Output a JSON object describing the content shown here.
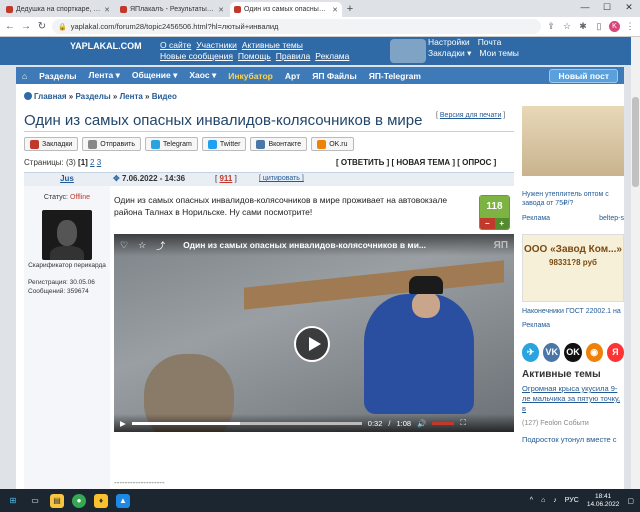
{
  "browser": {
    "tabs": [
      {
        "label": "Дедушка на спорткаре, пытаю"
      },
      {
        "label": "ЯПлакалъ - Результаты поиска"
      },
      {
        "label": "Один из самых опасных инвал"
      }
    ],
    "active_tab": 2,
    "new_tab": "+",
    "url": "yaplakal.com/forum28/topic2456506.html?hl=лютый+инвалид",
    "profile_letter": "K"
  },
  "site": {
    "logo": "YAPLAKAL.COM",
    "links_row1": [
      "О сайте",
      "Участники",
      "Активные темы"
    ],
    "links_row2": [
      "Новые сообщения",
      "Помощь",
      "Правила",
      "Реклама"
    ],
    "right_row1": [
      "Настройки",
      "Почта"
    ],
    "right_row2": [
      "Закладки ▾",
      "Мои темы"
    ]
  },
  "menu": {
    "items": [
      "Разделы",
      "Лента ▾",
      "Общение ▾",
      "Хаос ▾",
      "Инкубатор",
      "Арт",
      "ЯП Файлы",
      "ЯП-Telegram"
    ],
    "new_post": "Новый пост"
  },
  "breadcrumb": [
    "Главная",
    "Разделы",
    "Лента",
    "Видео"
  ],
  "topic": {
    "title": "Один из самых опасных инвалидов-колясочников в мире",
    "print_version": "Версия для печати"
  },
  "share": [
    "Закладки",
    "Отправить",
    "Telegram",
    "Twitter",
    "Вконтакте",
    "OK.ru"
  ],
  "pagination": {
    "label": "Страницы:",
    "count": "(3)",
    "current": "[1]",
    "others": [
      "2",
      "3"
    ]
  },
  "actions": "[ ОТВЕТИТЬ ] [ НОВАЯ ТЕМА ] [ ОПРОС ]",
  "post": {
    "author": "Jus",
    "date": "7.06.2022 - 14:36",
    "number": "911",
    "cite": "[ цитировать ]",
    "status_label": "Статус:",
    "status_value": "Offline",
    "user_title": "Скарификатор перикарда",
    "reg": "Регистрация: 30.05.06",
    "messages": "Сообщений: 359674",
    "text": "Один из самых опасных инвалидов-колясочников в мире проживает на автовокзале района Талнах в Норильске. Ну сами посмотрите!",
    "rating": "118",
    "rating_minus": "−",
    "rating_plus": "+",
    "separator": "-------------------"
  },
  "video": {
    "title": "Один из самых опасных инвалидов-колясочников в ми...",
    "watermark": "ЯП",
    "time_current": "0:32",
    "time_sep": "/",
    "time_total": "1:08",
    "progress": 0.47
  },
  "sidebar": {
    "ad1_text": "Нужен утеплитель оптом с завода от 75₽/?",
    "ad1_src": [
      "Реклама",
      "belteр-s"
    ],
    "ad2_title": "ООО «Завод Ком...»",
    "ad2_num": "98331?8 руб",
    "ad2_text": "Наконечники ГОСТ 22002.1 на",
    "ad2_src": "Реклама",
    "socials": [
      "✈",
      "VK",
      "OK",
      "◉",
      "Я"
    ],
    "active_title": "Активные темы",
    "active_link": "Огромная крыса укусила 9-ле мальчика за пятую точку, в",
    "active_meta": "(127)  Feolon  Событи",
    "active_link2": "Подросток утонул вместе с"
  },
  "taskbar": {
    "lang": "РУС",
    "time": "18:41",
    "date": "14.06.2022"
  },
  "colors": {
    "header": "#2f6aa6",
    "menu": "#3e7ab8",
    "accent": "#c0392b",
    "rating": "#7cb342"
  }
}
